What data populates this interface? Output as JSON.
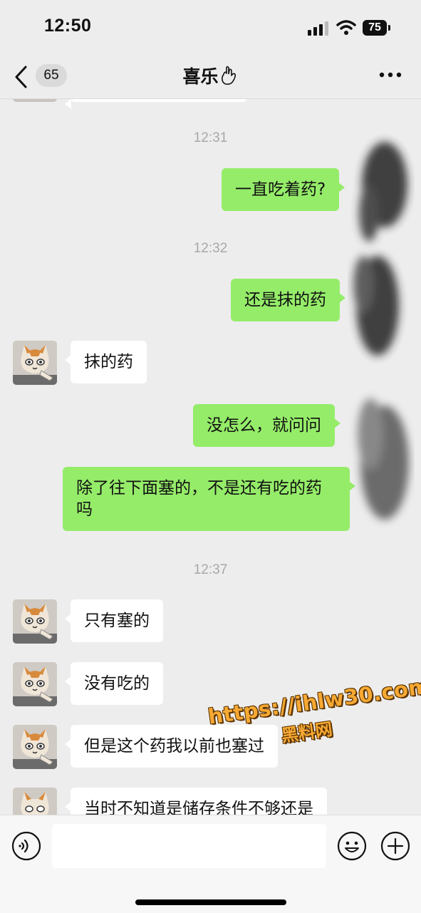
{
  "status": {
    "time": "12:50",
    "battery": "75"
  },
  "header": {
    "unread": "65",
    "title": "喜乐"
  },
  "messages": [
    {
      "type": "time",
      "text": "12:31"
    },
    {
      "type": "me",
      "text": "一直吃着药?"
    },
    {
      "type": "time",
      "text": "12:32"
    },
    {
      "type": "me",
      "text": "还是抹的药"
    },
    {
      "type": "other",
      "text": "抹的药"
    },
    {
      "type": "me",
      "text": "没怎么，就问问"
    },
    {
      "type": "me",
      "text": "除了往下面塞的，不是还有吃的药吗"
    },
    {
      "type": "time",
      "text": "12:37"
    },
    {
      "type": "other",
      "text": "只有塞的"
    },
    {
      "type": "other",
      "text": "没有吃的"
    },
    {
      "type": "other",
      "text": "但是这个药我以前也塞过"
    },
    {
      "type": "other",
      "text": "当时不知道是储存条件不够还是"
    }
  ],
  "watermark": {
    "url": "https://ihlw30.com",
    "name": "黑料网"
  },
  "input": {
    "value": ""
  },
  "icons": {
    "back": "chevron-left-icon",
    "more": "more-icon",
    "voice": "voice-icon",
    "emoji": "emoji-icon",
    "plus": "plus-icon",
    "signal": "signal-icon",
    "wifi": "wifi-icon",
    "battery": "battery-icon"
  },
  "colors": {
    "background": "#ededed",
    "my_bubble": "#95ec69",
    "other_bubble": "#ffffff",
    "watermark": "#f6a933"
  }
}
